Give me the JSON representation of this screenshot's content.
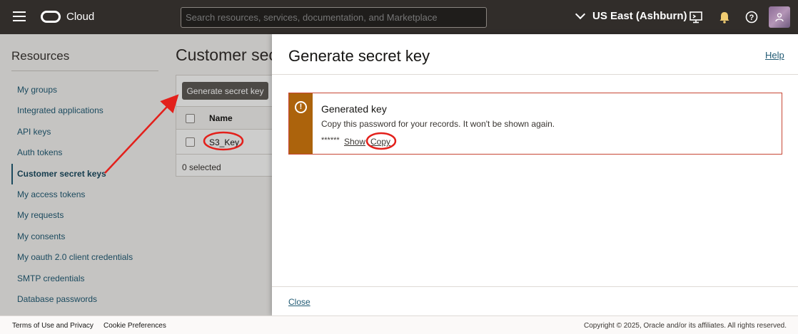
{
  "topbar": {
    "brand": "Cloud",
    "search_placeholder": "Search resources, services, documentation, and Marketplace",
    "region": "US East (Ashburn)",
    "icons": [
      "menu-icon",
      "oracle-logo",
      "chevron-down-icon",
      "cloud-shell-icon",
      "notification-bell-icon",
      "help-icon",
      "user-avatar"
    ]
  },
  "sidebar": {
    "title": "Resources",
    "items": [
      {
        "label": "My groups"
      },
      {
        "label": "Integrated applications"
      },
      {
        "label": "API keys"
      },
      {
        "label": "Auth tokens"
      },
      {
        "label": "Customer secret keys",
        "active": true
      },
      {
        "label": "My access tokens"
      },
      {
        "label": "My requests"
      },
      {
        "label": "My consents"
      },
      {
        "label": "My oauth 2.0 client credentials"
      },
      {
        "label": "SMTP credentials"
      },
      {
        "label": "Database passwords"
      }
    ]
  },
  "background_page": {
    "title": "Customer secret keys",
    "generate_button": "Generate secret key",
    "table": {
      "columns": [
        "Name"
      ],
      "rows": [
        {
          "name": "S3_Key"
        }
      ]
    },
    "selected_count": "0 selected"
  },
  "drawer": {
    "title": "Generate secret key",
    "help": "Help",
    "alert": {
      "icon": "warning-icon",
      "title": "Generated key",
      "message": "Copy this password for your records. It won't be shown again.",
      "masked_value": "******",
      "show_label": "Show",
      "copy_label": "Copy"
    },
    "close_label": "Close"
  },
  "footer": {
    "terms": "Terms of Use and Privacy",
    "cookies": "Cookie Preferences",
    "copyright": "Copyright © 2025, Oracle and/or its affiliates. All rights reserved."
  },
  "colors": {
    "topbar": "#312d2a",
    "link": "#235c75",
    "alert_bar": "#ac630c",
    "alert_border": "#c74634",
    "annotation": "#e3201b"
  }
}
